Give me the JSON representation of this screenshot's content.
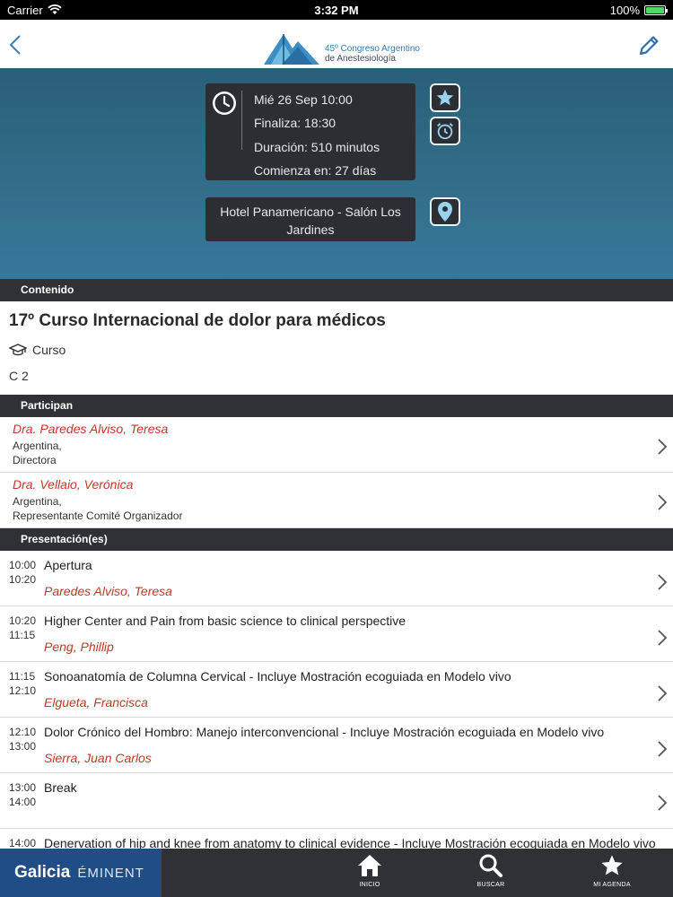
{
  "status_bar": {
    "carrier": "Carrier",
    "time": "3:32 PM",
    "battery": "100%"
  },
  "header": {
    "logo_line1": "45º Congreso Argentino",
    "logo_line2": "de Anestesiología"
  },
  "event_info": {
    "start": "Mié 26  Sep  10:00",
    "end": "Finaliza: 18:30",
    "duration": "Duración: 510 minutos",
    "starts_in": "Comienza en: 27 días",
    "location": "Hotel Panamericano - Salón Los Jardines"
  },
  "sections": {
    "content": "Contenido",
    "participants": "Participan",
    "presentations": "Presentación(es)"
  },
  "content": {
    "title": "17º Curso Internacional de dolor para médicos",
    "type": "Curso",
    "room": "C 2"
  },
  "participants": [
    {
      "name": "Dra. Paredes Alviso, Teresa",
      "country": "Argentina,",
      "role": "Directora"
    },
    {
      "name": "Dra. Vellaio, Verónica",
      "country": "Argentina,",
      "role": "Representante Comité Organizador"
    }
  ],
  "presentations": [
    {
      "start": "10:00",
      "end": "10:20",
      "title": "Apertura",
      "speaker": "Paredes Alviso, Teresa"
    },
    {
      "start": "10:20",
      "end": "11:15",
      "title": "Higher Center and Pain from basic science to clinical perspective",
      "speaker": "Peng, Phillip"
    },
    {
      "start": "11:15",
      "end": "12:10",
      "title": "Sonoanatomía de Columna Cervical - Incluye Mostración ecoguiada en Modelo vivo",
      "speaker": "Elgueta, Francisca"
    },
    {
      "start": "12:10",
      "end": "13:00",
      "title": "Dolor Crónico del Hombro: Manejo interconvencional - Incluye Mostración ecoguiada en Modelo vivo",
      "speaker": "Sierra, Juan Carlos"
    },
    {
      "start": "13:00",
      "end": "14:00",
      "title": "Break",
      "speaker": ""
    },
    {
      "start": "14:00",
      "end": "",
      "title": "Denervation of hip and knee from anatomy to clinical evidence - Incluye Mostración ecoguiada en Modelo vivo",
      "speaker": ""
    }
  ],
  "tab_bar": {
    "brand_main": "Galicia",
    "brand_sub": "ÉMINENT",
    "tabs": [
      {
        "label": "INICIO"
      },
      {
        "label": "BUSCAR"
      },
      {
        "label": "MI AGENDA"
      }
    ]
  },
  "colors": {
    "hero": "#326f8b",
    "dark": "#2f3134",
    "speaker": "#c0392b",
    "brand": "#1f4e86"
  }
}
